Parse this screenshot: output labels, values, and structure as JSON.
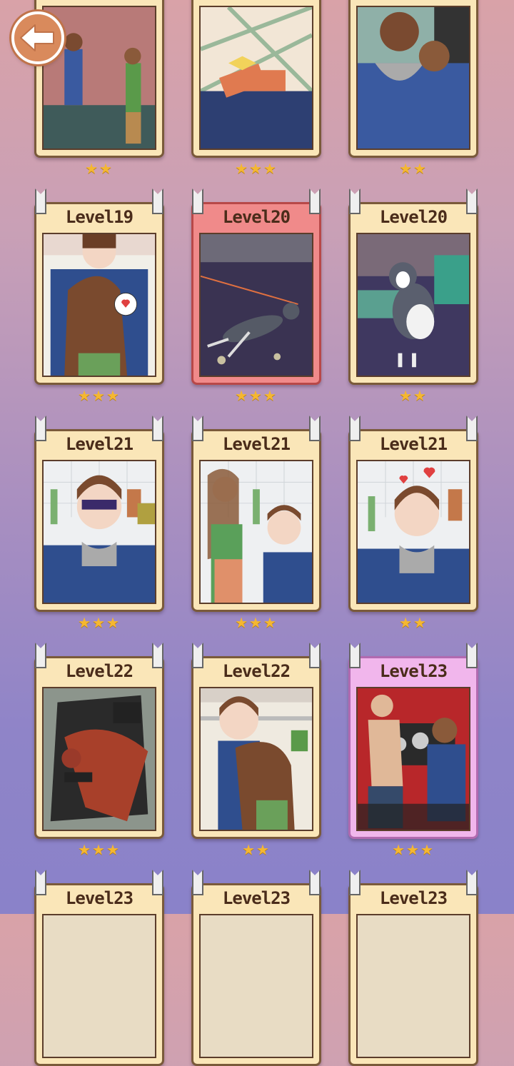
{
  "back_icon": "back-arrow-icon",
  "colors": {
    "star": "#f5b730",
    "card": "#fae6b8",
    "card_selected": "#f08a8a",
    "card_new": "#f1b6ec"
  },
  "cards": [
    {
      "title": "",
      "stars": 2,
      "style": "normal",
      "scene": "karaoke"
    },
    {
      "title": "",
      "stars": 3,
      "style": "normal",
      "scene": "gift"
    },
    {
      "title": "",
      "stars": 2,
      "style": "normal",
      "scene": "hug-back"
    },
    {
      "title": "Level19",
      "stars": 3,
      "style": "normal",
      "scene": "couple-heart"
    },
    {
      "title": "Level20",
      "stars": 3,
      "style": "red",
      "scene": "dog-running"
    },
    {
      "title": "Level20",
      "stars": 2,
      "style": "normal",
      "scene": "dog-sitting"
    },
    {
      "title": "Level21",
      "stars": 3,
      "style": "normal",
      "scene": "boy-eating-sick"
    },
    {
      "title": "Level21",
      "stars": 3,
      "style": "normal",
      "scene": "girl-feeding"
    },
    {
      "title": "Level21",
      "stars": 2,
      "style": "normal",
      "scene": "boy-eating-happy"
    },
    {
      "title": "Level22",
      "stars": 3,
      "style": "normal",
      "scene": "villain-cape"
    },
    {
      "title": "Level22",
      "stars": 2,
      "style": "normal",
      "scene": "couple-hug"
    },
    {
      "title": "Level23",
      "stars": 3,
      "style": "pink",
      "scene": "shirtless-man"
    },
    {
      "title": "Level23",
      "stars": 0,
      "style": "normal",
      "scene": ""
    },
    {
      "title": "Level23",
      "stars": 0,
      "style": "normal",
      "scene": ""
    },
    {
      "title": "Level23",
      "stars": 0,
      "style": "normal",
      "scene": ""
    }
  ]
}
